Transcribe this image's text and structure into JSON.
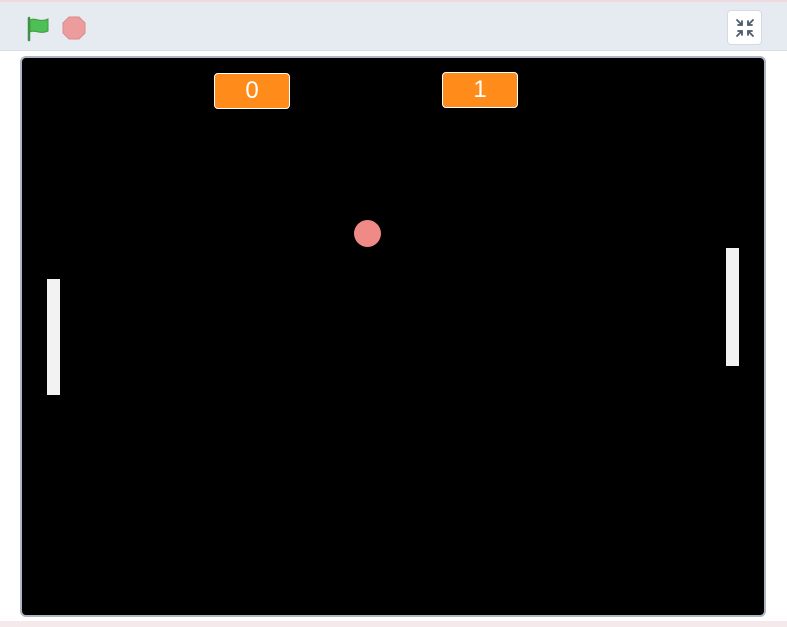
{
  "toolbar": {
    "green_flag": {
      "icon": "green-flag-icon",
      "color": "#4cbf56"
    },
    "stop": {
      "icon": "stop-icon",
      "color": "#ec9c9c"
    },
    "exit_fullscreen": {
      "icon": "exit-fullscreen-icon"
    }
  },
  "stage": {
    "background": "#000000",
    "score_left": "0",
    "score_right": "1",
    "score_color": "#ff8c1a",
    "ball_color": "#f08a86",
    "paddle_color": "#f2f2f2"
  }
}
